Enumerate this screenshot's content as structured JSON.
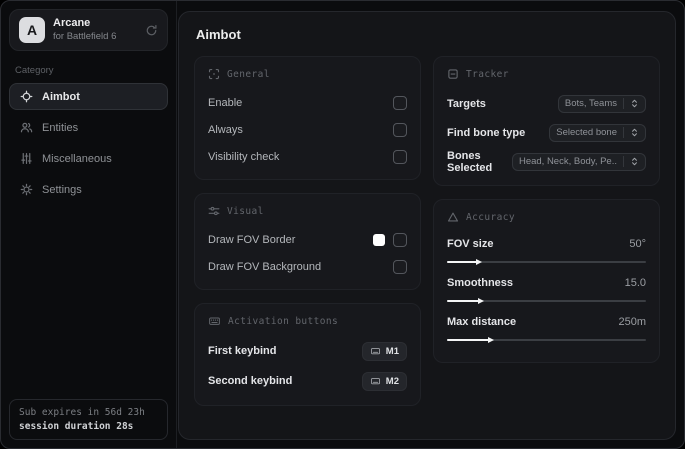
{
  "app": {
    "name": "Arcane",
    "subtitle": "for Battlefield 6",
    "logo_letter": "A"
  },
  "sidebar": {
    "category_label": "Category",
    "items": [
      {
        "label": "Aimbot",
        "icon": "crosshair-icon",
        "selected": true
      },
      {
        "label": "Entities",
        "icon": "users-icon",
        "selected": false
      },
      {
        "label": "Miscellaneous",
        "icon": "mixer-sliders-icon",
        "selected": false
      },
      {
        "label": "Settings",
        "icon": "gear-icon",
        "selected": false
      }
    ],
    "subscription": {
      "expires": "Sub expires in 56d 23h",
      "session": "session duration 28s"
    }
  },
  "main": {
    "title": "Aimbot",
    "sections": {
      "general": {
        "title": "General",
        "icon": "scan-icon",
        "rows": [
          {
            "label": "Enable",
            "checked": false
          },
          {
            "label": "Always",
            "checked": false
          },
          {
            "label": "Visibility check",
            "checked": false
          }
        ]
      },
      "visual": {
        "title": "Visual",
        "icon": "adjust-icon",
        "rows": [
          {
            "label": "Draw FOV Border",
            "swatch_color": "#ffffff",
            "checked": false
          },
          {
            "label": "Draw FOV Background",
            "checked": false
          }
        ]
      },
      "activation": {
        "title": "Activation buttons",
        "icon": "keyboard-icon",
        "rows": [
          {
            "label": "First keybind",
            "key": "M1"
          },
          {
            "label": "Second keybind",
            "key": "M2"
          }
        ]
      },
      "tracker": {
        "title": "Tracker",
        "icon": "box-minus-icon",
        "rows": [
          {
            "label": "Targets",
            "value": "Bots, Teams"
          },
          {
            "label": "Find bone type",
            "value": "Selected bone"
          },
          {
            "label": "Bones Selected",
            "value": "Head, Neck, Body, Pe.."
          }
        ]
      },
      "accuracy": {
        "title": "Accuracy",
        "icon": "triangle-icon",
        "rows": [
          {
            "label": "FOV size",
            "value": "50°",
            "fill": "15%"
          },
          {
            "label": "Smoothness",
            "value": "15.0",
            "fill": "16%"
          },
          {
            "label": "Max distance",
            "value": "250m",
            "fill": "21%"
          }
        ]
      }
    }
  },
  "colors": {
    "accent_fill": "#f4f5f6",
    "swatch_white": "#ffffff",
    "card_bg": "#17181c"
  }
}
